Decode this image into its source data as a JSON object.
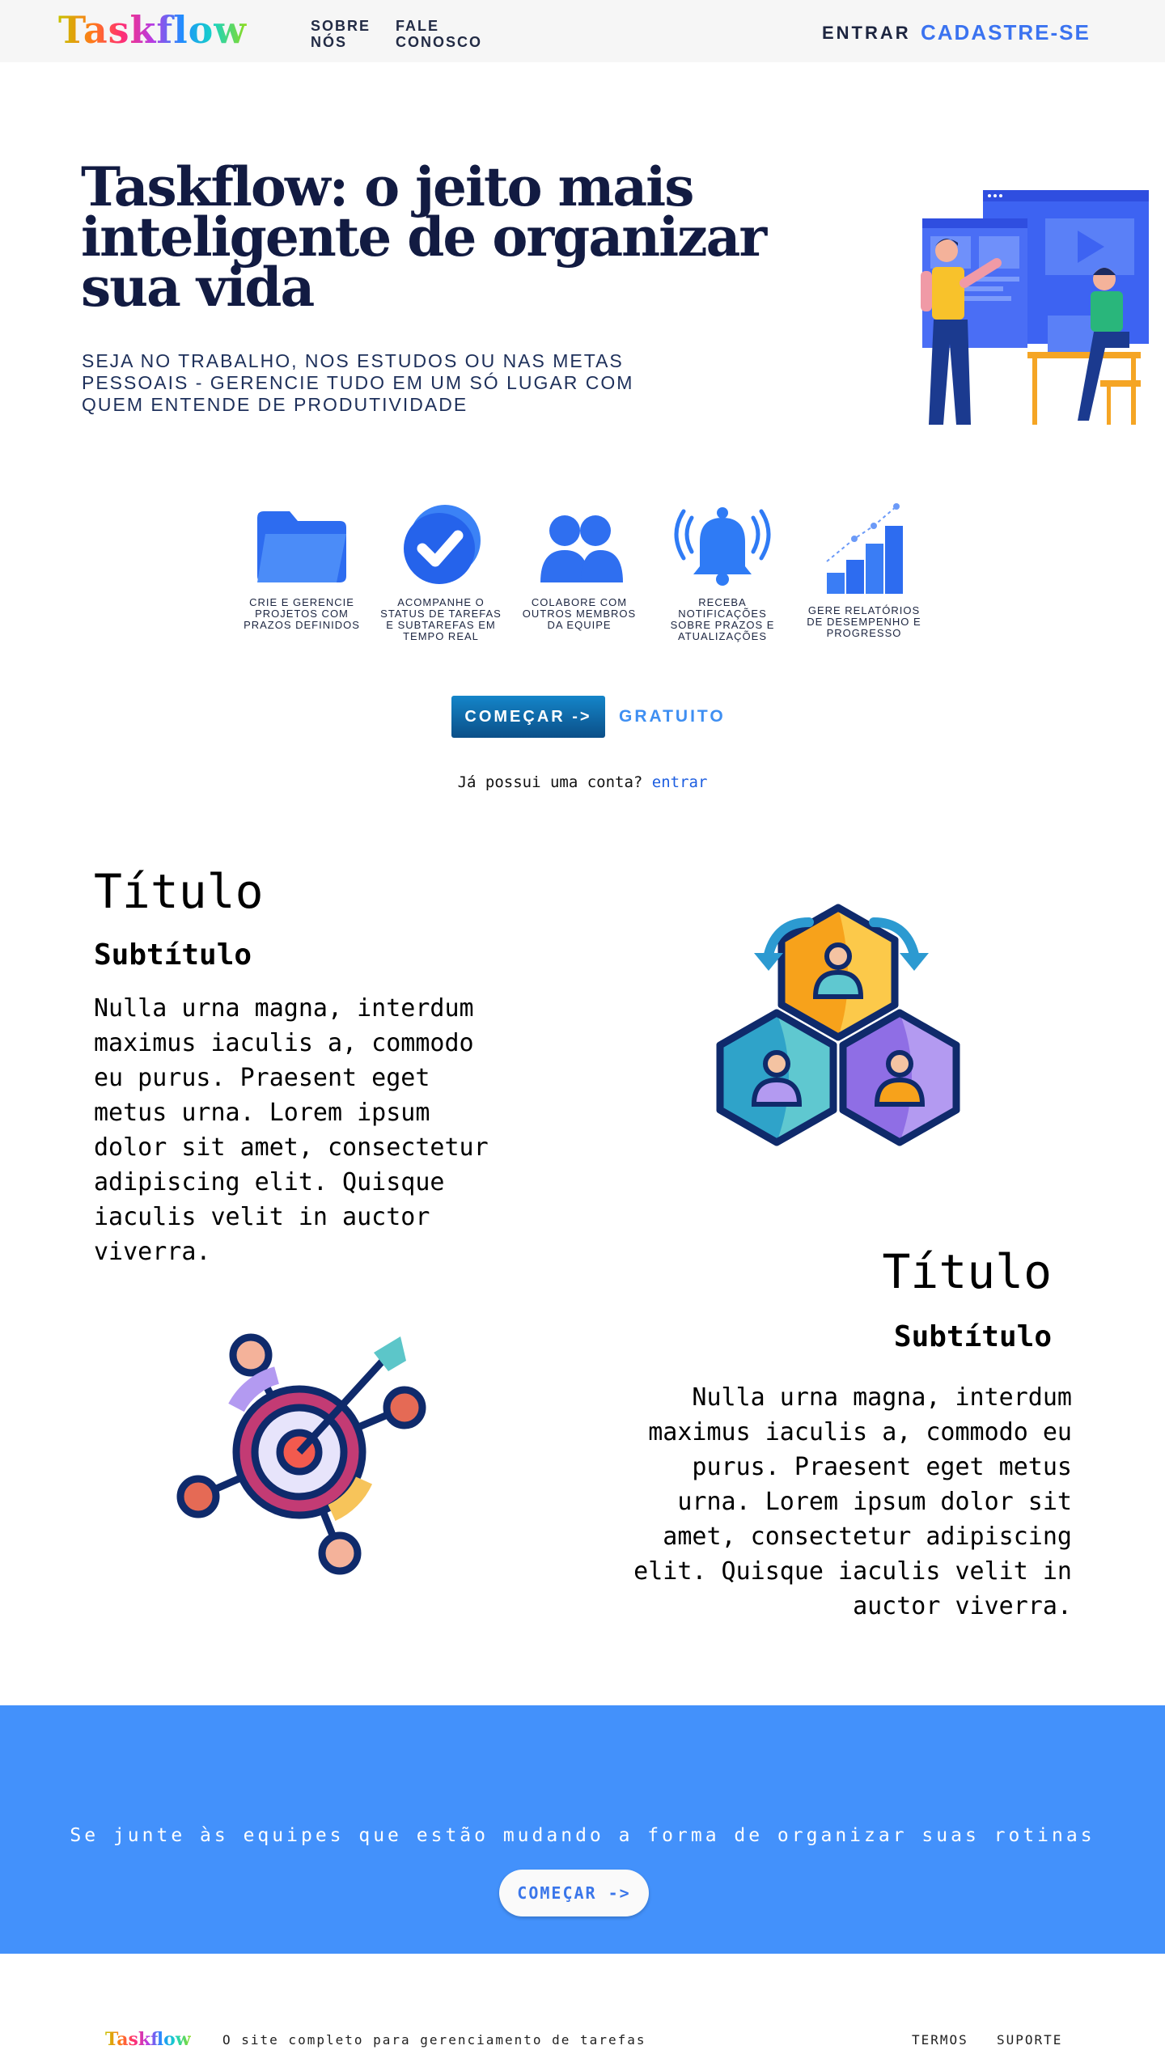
{
  "nav": {
    "logo": "Taskflow",
    "about": "SOBRE\nNÓS",
    "contact": "FALE\nCONOSCO",
    "login": "ENTRAR",
    "signup": "CADASTRE-SE"
  },
  "hero": {
    "title": "Taskflow: o jeito mais inteligente de organizar sua vida",
    "subtitle": "SEJA NO TRABALHO, NOS ESTUDOS OU NAS METAS PESSOAIS - GERENCIE TUDO EM UM SÓ LUGAR COM QUEM ENTENDE DE PRODUTIVIDADE"
  },
  "features": [
    {
      "icon": "folder-icon",
      "label": "CRIE E GERENCIE PROJETOS COM PRAZOS DEFINIDOS"
    },
    {
      "icon": "check-circle-icon",
      "label": "ACOMPANHE O STATUS DE TAREFAS E SUBTAREFAS EM TEMPO REAL"
    },
    {
      "icon": "users-icon",
      "label": "COLABORE COM OUTROS MEMBROS DA EQUIPE"
    },
    {
      "icon": "bell-icon",
      "label": "RECEBA NOTIFICAÇÕES SOBRE PRAZOS E ATUALIZAÇÕES"
    },
    {
      "icon": "bar-chart-icon",
      "label": "GERE RELATÓRIOS DE DESEMPENHO E PROGRESSO"
    }
  ],
  "cta": {
    "start": "COMEÇAR ->",
    "free": "GRATUITO",
    "have_account": "Já possui uma conta?",
    "login_link": "entrar"
  },
  "section1": {
    "title": "Título",
    "subtitle": "Subtítulo",
    "body": "Nulla urna magna, interdum maximus iaculis a, commodo eu purus. Praesent eget metus urna. Lorem ipsum dolor sit amet, consectetur adipiscing elit. Quisque iaculis velit in auctor viverra."
  },
  "section2": {
    "title": "Título",
    "subtitle": "Subtítulo",
    "body": "Nulla urna magna, interdum maximus iaculis a, commodo eu purus. Praesent eget metus urna. Lorem ipsum dolor sit amet, consectetur adipiscing elit. Quisque iaculis velit in auctor viverra."
  },
  "banner": {
    "text": "Se junte às equipes que estão mudando a forma de organizar suas rotinas",
    "button": "COMEÇAR ->",
    "color": "#4391fb"
  },
  "footer": {
    "logo": "Taskflow",
    "tagline": "O site completo para gerenciamento de tarefas",
    "terms": "TERMOS",
    "support": "SUPORTE"
  },
  "colors": {
    "accent": "#3b73f0",
    "dark_navy": "#121b42"
  }
}
